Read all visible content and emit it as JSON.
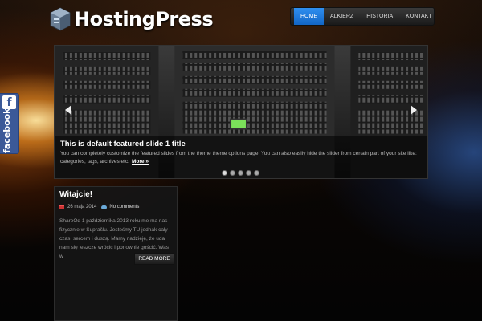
{
  "site": {
    "title": "HostingPress"
  },
  "nav": {
    "items": [
      "HOME",
      "ALKIERZ",
      "HISTORIA",
      "KONTAKT"
    ],
    "active_index": 0
  },
  "slider": {
    "title": "This is default featured slide 1 title",
    "text": "You can completely customize the featured slides from the theme theme options page. You can also easily hide the slider from certain part of your site like: categories, tags, archives etc.",
    "more": "More »",
    "dots": 5,
    "active_dot": 0
  },
  "facebook": {
    "label": "facebook",
    "letter": "f"
  },
  "post": {
    "title": "Witajcie!",
    "date": "26 maja 2014",
    "comments": "No comments",
    "excerpt": "ShareOd 1 października 2013 roku me ma nas fizycznie w Suprašlu. Jesteśmy TU jednak cały czas, sercem i duszą. Mamy nadzieję, że uda nam się jeszcze wrócić i ponownie gościć. Was w",
    "read_more": "READ MORE"
  },
  "colors": {
    "accent": "#1a78dc",
    "facebook": "#3b5998"
  }
}
